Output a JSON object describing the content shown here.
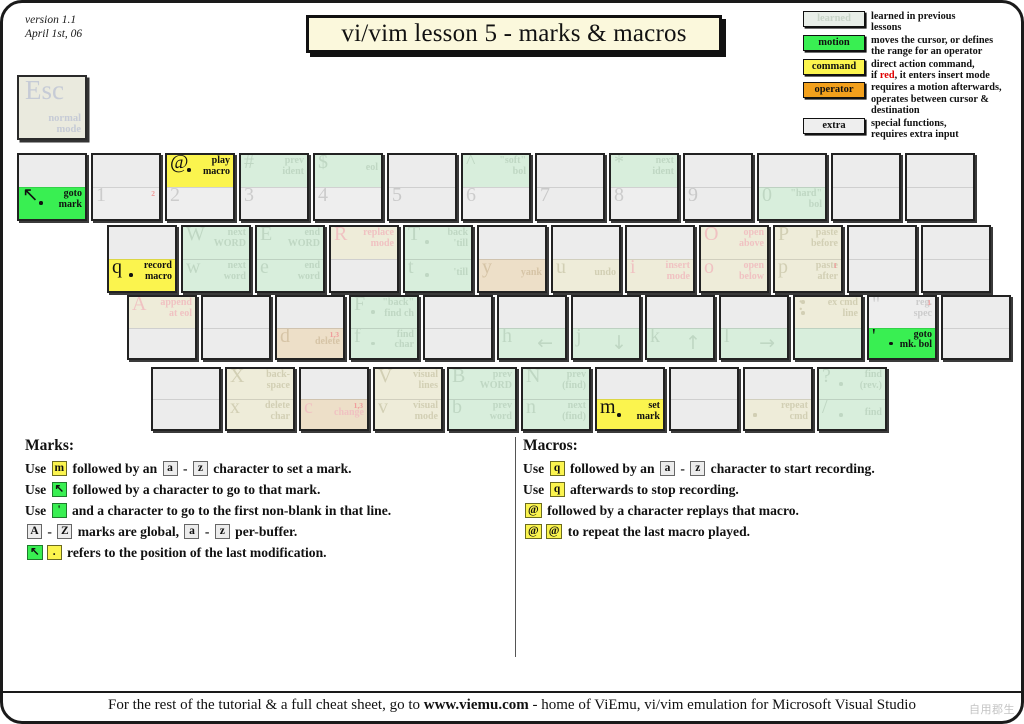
{
  "meta": {
    "version_line1": "version 1.1",
    "version_line2": "April 1st, 06",
    "title": "vi/vim lesson 5 - marks & macros"
  },
  "colors": {
    "learned": "#e8eee8",
    "motion": "#39ef52",
    "command": "#fbf44e",
    "operator": "#f2a01c",
    "extra": "#eeeeee",
    "insert_red": "#e00000",
    "paper": "#ffffff",
    "title_bg": "#fbf8dc"
  },
  "legend": [
    {
      "chip": "learned",
      "desc_line1": "learned in previous",
      "desc_line2": "lessons"
    },
    {
      "chip": "motion",
      "desc_line1": "moves the cursor, or defines",
      "desc_line2": "the range for an operator"
    },
    {
      "chip": "command",
      "desc_line1": "direct action command,",
      "desc_line2": "if red, it enters insert mode"
    },
    {
      "chip": "operator",
      "desc_line1": "requires a motion afterwards,",
      "desc_line2": "operates between cursor  &",
      "desc_line3": "destination"
    },
    {
      "chip": "extra",
      "desc_line1": "special functions,",
      "desc_line2": "requires extra input"
    }
  ],
  "esc_key": {
    "glyph": "Esc",
    "label_line1": "normal",
    "label_line2": "mode"
  },
  "keyboard": {
    "row_number": [
      {
        "key": "grave",
        "top": {},
        "bottom": {
          "glyph": "↖",
          "label_line1": "goto",
          "label_line2": "mark",
          "style": "motion",
          "dot": true
        }
      },
      {
        "key": "1",
        "top": {},
        "bottom": {
          "glyph": "1",
          "style": "learn-grey",
          "sup": "2"
        }
      },
      {
        "key": "2",
        "top": {
          "glyph": "@",
          "label_line1": "play",
          "label_line2": "macro",
          "style": "command",
          "dot": true
        },
        "bottom": {
          "glyph": "2",
          "style": "learn-grey"
        }
      },
      {
        "key": "3",
        "top": {
          "glyph": "#",
          "label_line1": "prev",
          "label_line2": "ident",
          "style": "learn-green"
        },
        "bottom": {
          "glyph": "3",
          "style": "learn-grey"
        }
      },
      {
        "key": "4",
        "top": {
          "glyph": "$",
          "label_line1": "eol",
          "style": "learn-green"
        },
        "bottom": {
          "glyph": "4",
          "style": "learn-grey"
        }
      },
      {
        "key": "5",
        "top": {},
        "bottom": {
          "glyph": "5",
          "style": "plain"
        }
      },
      {
        "key": "6",
        "top": {
          "glyph": "^",
          "label_line1": "\"soft\"",
          "label_line2": "bol",
          "style": "learn-green"
        },
        "bottom": {
          "glyph": "6",
          "style": "learn-grey"
        }
      },
      {
        "key": "7",
        "top": {},
        "bottom": {
          "glyph": "7",
          "style": "plain"
        }
      },
      {
        "key": "8",
        "top": {
          "glyph": "*",
          "label_line1": "next",
          "label_line2": "ident",
          "style": "learn-green"
        },
        "bottom": {
          "glyph": "8",
          "style": "learn-grey"
        }
      },
      {
        "key": "9",
        "top": {},
        "bottom": {
          "glyph": "9",
          "style": "plain"
        }
      },
      {
        "key": "0",
        "top": {},
        "bottom": {
          "glyph": "0",
          "label_line1": "\"hard\"",
          "label_line2": "bol",
          "style": "learn-green"
        }
      },
      {
        "key": "minus",
        "top": {},
        "bottom": {}
      },
      {
        "key": "equals",
        "top": {},
        "bottom": {}
      }
    ],
    "row_qwerty": [
      {
        "key": "q",
        "top": {},
        "bottom": {
          "glyph": "q",
          "label_line1": "record",
          "label_line2": "macro",
          "style": "command",
          "dot": true
        }
      },
      {
        "key": "w",
        "top": {
          "glyph": "W",
          "label_line1": "next",
          "label_line2": "WORD",
          "style": "learn-green"
        },
        "bottom": {
          "glyph": "w",
          "label_line1": "next",
          "label_line2": "word",
          "style": "learn-green"
        }
      },
      {
        "key": "e",
        "top": {
          "glyph": "E",
          "label_line1": "end",
          "label_line2": "WORD",
          "style": "learn-green"
        },
        "bottom": {
          "glyph": "e",
          "label_line1": "end",
          "label_line2": "word",
          "style": "learn-green"
        }
      },
      {
        "key": "r",
        "top": {
          "glyph": "R",
          "label_line1": "replace",
          "label_line2": "mode",
          "style": "learn-cream",
          "red": true
        },
        "bottom": {
          "style": "plain"
        }
      },
      {
        "key": "t",
        "top": {
          "glyph": "T",
          "label_line1": "back",
          "label_line2": "'till",
          "style": "learn-green",
          "dot": true
        },
        "bottom": {
          "glyph": "t",
          "label_line1": "'till",
          "style": "learn-green",
          "dot": true
        }
      },
      {
        "key": "y",
        "top": {},
        "bottom": {
          "glyph": "y",
          "label_line1": "yank",
          "style": "learn-tan"
        }
      },
      {
        "key": "u",
        "top": {},
        "bottom": {
          "glyph": "u",
          "label_line1": "undo",
          "style": "learn-cream"
        }
      },
      {
        "key": "i",
        "top": {},
        "bottom": {
          "glyph": "i",
          "label_line1": "insert",
          "label_line2": "mode",
          "style": "learn-cream",
          "red": true
        }
      },
      {
        "key": "o",
        "top": {
          "glyph": "O",
          "label_line1": "open",
          "label_line2": "above",
          "style": "learn-cream",
          "red": true
        },
        "bottom": {
          "glyph": "o",
          "label_line1": "open",
          "label_line2": "below",
          "style": "learn-cream",
          "red": true
        }
      },
      {
        "key": "p",
        "top": {
          "glyph": "P",
          "label_line1": "paste",
          "label_line2": "before",
          "style": "learn-cream"
        },
        "bottom": {
          "glyph": "p",
          "label_line1": "paste",
          "label_line2": "after",
          "style": "learn-cream",
          "sup": "1"
        }
      },
      {
        "key": "bracketleft",
        "top": {},
        "bottom": {}
      },
      {
        "key": "bracketright",
        "top": {},
        "bottom": {}
      }
    ],
    "row_home": [
      {
        "key": "a",
        "top": {
          "glyph": "A",
          "label_line1": "append",
          "label_line2": "at eol",
          "style": "learn-cream",
          "red": true
        },
        "bottom": {
          "style": "plain"
        }
      },
      {
        "key": "s",
        "top": {},
        "bottom": {}
      },
      {
        "key": "d",
        "top": {},
        "bottom": {
          "glyph": "d",
          "label_line1": "delete",
          "style": "learn-tan",
          "sup": "1,3"
        }
      },
      {
        "key": "f",
        "top": {
          "glyph": "F",
          "label_line1": "\"back\"",
          "label_line2": "find ch",
          "style": "learn-green",
          "dot": true
        },
        "bottom": {
          "glyph": "f",
          "label_line1": "find",
          "label_line2": "char",
          "style": "learn-green",
          "dot": true
        }
      },
      {
        "key": "g",
        "top": {},
        "bottom": {}
      },
      {
        "key": "h",
        "top": {},
        "bottom": {
          "glyph": "h",
          "label_line1": "←",
          "style": "learn-green",
          "arrow": true
        }
      },
      {
        "key": "j",
        "top": {},
        "bottom": {
          "glyph": "j",
          "label_line1": "↓",
          "style": "learn-green",
          "arrow": true
        }
      },
      {
        "key": "k",
        "top": {},
        "bottom": {
          "glyph": "k",
          "label_line1": "↑",
          "style": "learn-green",
          "arrow": true
        }
      },
      {
        "key": "l",
        "top": {},
        "bottom": {
          "glyph": "l",
          "label_line1": "→",
          "style": "learn-green",
          "arrow": true
        }
      },
      {
        "key": "semicolon",
        "top": {
          "glyph": ":",
          "label_line1": "ex cmd",
          "label_line2": "line",
          "style": "learn-cream"
        },
        "bottom": {
          "style": "learn-green"
        }
      },
      {
        "key": "quote",
        "top": {
          "glyph": "\"",
          "label_line1": "reg.",
          "label_line2": "spec",
          "style": "learn-grey",
          "sup": "1"
        },
        "bottom": {
          "glyph": "'",
          "label_line1": "goto",
          "label_line2": "mk. bol",
          "style": "motion",
          "dot": true
        }
      },
      {
        "key": "enter",
        "top": {},
        "bottom": {}
      }
    ],
    "row_bottom": [
      {
        "key": "shift",
        "top": {},
        "bottom": {}
      },
      {
        "key": "x",
        "top": {
          "glyph": "X",
          "label_line1": "back-",
          "label_line2": "space",
          "style": "learn-cream"
        },
        "bottom": {
          "glyph": "x",
          "label_line1": "delete",
          "label_line2": "char",
          "style": "learn-cream"
        }
      },
      {
        "key": "c",
        "top": {
          "style": "plain"
        },
        "bottom": {
          "glyph": "c",
          "label_line1": "change",
          "style": "learn-tan",
          "red": true,
          "sup": "1,3"
        }
      },
      {
        "key": "v",
        "top": {
          "glyph": "V",
          "label_line1": "visual",
          "label_line2": "lines",
          "style": "learn-cream"
        },
        "bottom": {
          "glyph": "v",
          "label_line1": "visual",
          "label_line2": "mode",
          "style": "learn-cream"
        }
      },
      {
        "key": "b",
        "top": {
          "glyph": "B",
          "label_line1": "prev",
          "label_line2": "WORD",
          "style": "learn-green"
        },
        "bottom": {
          "glyph": "b",
          "label_line1": "prev",
          "label_line2": "word",
          "style": "learn-green"
        }
      },
      {
        "key": "n",
        "top": {
          "glyph": "N",
          "label_line1": "prev",
          "label_line2": "(find)",
          "style": "learn-green"
        },
        "bottom": {
          "glyph": "n",
          "label_line1": "next",
          "label_line2": "(find)",
          "style": "learn-green"
        }
      },
      {
        "key": "m",
        "top": {},
        "bottom": {
          "glyph": "m",
          "label_line1": "set",
          "label_line2": "mark",
          "style": "command",
          "dot": true
        }
      },
      {
        "key": "comma",
        "top": {},
        "bottom": {}
      },
      {
        "key": "period",
        "top": {},
        "bottom": {
          "label_line1": "repeat",
          "label_line2": "cmd",
          "style": "learn-cream",
          "dot": true
        }
      },
      {
        "key": "slash",
        "top": {
          "glyph": "?",
          "label_line1": "find",
          "label_line2": "(rev.)",
          "style": "learn-green",
          "dot": true
        },
        "bottom": {
          "glyph": "/",
          "label_line1": "find",
          "style": "learn-green",
          "dot": true
        }
      }
    ]
  },
  "marks_section": {
    "heading": "Marks:",
    "lines": [
      {
        "parts": [
          {
            "t": "text",
            "v": "Use "
          },
          {
            "t": "key",
            "v": "m",
            "style": "yellow"
          },
          {
            "t": "text",
            "v": " followed by an "
          },
          {
            "t": "key",
            "v": "a",
            "style": "grey"
          },
          {
            "t": "text",
            "v": " - "
          },
          {
            "t": "key",
            "v": "z",
            "style": "grey"
          },
          {
            "t": "text",
            "v": " character to set a mark."
          }
        ]
      },
      {
        "parts": [
          {
            "t": "text",
            "v": "Use "
          },
          {
            "t": "key",
            "v": "↖",
            "style": "green"
          },
          {
            "t": "text",
            "v": " followed by a character to go to that mark."
          }
        ]
      },
      {
        "parts": [
          {
            "t": "text",
            "v": "Use "
          },
          {
            "t": "key",
            "v": "'",
            "style": "green"
          },
          {
            "t": "text",
            "v": " and a character to go to the first non-blank in that line."
          }
        ]
      },
      {
        "parts": [
          {
            "t": "key",
            "v": "A",
            "style": "grey"
          },
          {
            "t": "text",
            "v": " - "
          },
          {
            "t": "key",
            "v": "Z",
            "style": "grey"
          },
          {
            "t": "text",
            "v": " marks are global, "
          },
          {
            "t": "key",
            "v": "a",
            "style": "grey"
          },
          {
            "t": "text",
            "v": " - "
          },
          {
            "t": "key",
            "v": "z",
            "style": "grey"
          },
          {
            "t": "text",
            "v": " per-buffer."
          }
        ]
      },
      {
        "parts": [
          {
            "t": "key",
            "v": "↖",
            "style": "green"
          },
          {
            "t": "key",
            "v": ".",
            "style": "yellow"
          },
          {
            "t": "text",
            "v": " refers to the position of the last modification."
          }
        ]
      }
    ]
  },
  "macros_section": {
    "heading": "Macros:",
    "lines": [
      {
        "parts": [
          {
            "t": "text",
            "v": "Use "
          },
          {
            "t": "key",
            "v": "q",
            "style": "yellow"
          },
          {
            "t": "text",
            "v": " followed by an "
          },
          {
            "t": "key",
            "v": "a",
            "style": "grey"
          },
          {
            "t": "text",
            "v": " - "
          },
          {
            "t": "key",
            "v": "z",
            "style": "grey"
          },
          {
            "t": "text",
            "v": " character to start recording."
          }
        ]
      },
      {
        "parts": [
          {
            "t": "text",
            "v": "Use "
          },
          {
            "t": "key",
            "v": "q",
            "style": "yellow"
          },
          {
            "t": "text",
            "v": " afterwards to stop recording."
          }
        ]
      },
      {
        "parts": [
          {
            "t": "key",
            "v": "@",
            "style": "yellow"
          },
          {
            "t": "text",
            "v": " followed by a character replays that macro."
          }
        ]
      },
      {
        "parts": [
          {
            "t": "key",
            "v": "@",
            "style": "yellow"
          },
          {
            "t": "key",
            "v": "@",
            "style": "yellow"
          },
          {
            "t": "text",
            "v": " to repeat the last macro played."
          }
        ]
      }
    ]
  },
  "footer": {
    "pre": "For the rest of the tutorial & a full cheat sheet, go to ",
    "site": "www.viemu.com",
    "post": " - home of ViEmu, vi/vim emulation for Microsoft Visual Studio",
    "watermark": "自用郡生"
  }
}
